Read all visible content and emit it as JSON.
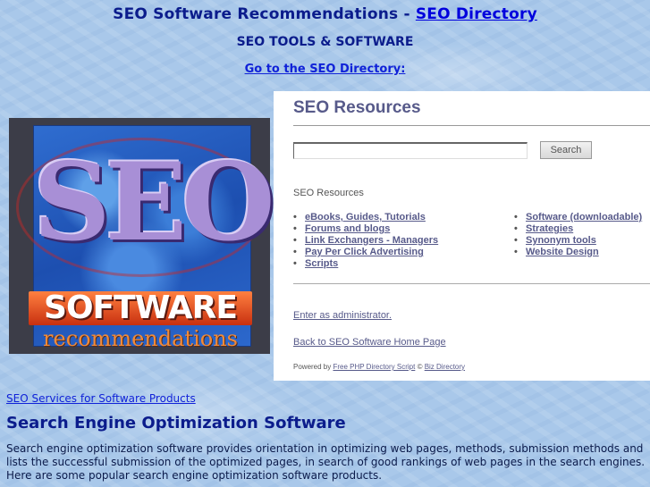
{
  "header": {
    "title_prefix": "SEO Software Recommendations - ",
    "title_link": "SEO Directory",
    "subtitle": "SEO TOOLS & SOFTWARE",
    "goto_link": "Go to the SEO Directory:"
  },
  "logo": {
    "seo_text": "SEO",
    "software_text": "SOFTWARE",
    "recommendations_text": "recommendations"
  },
  "panel": {
    "title": "SEO Resources",
    "search": {
      "value": "",
      "placeholder": "",
      "button_label": "Search"
    },
    "section_label": "SEO Resources",
    "categories_left": [
      "eBooks, Guides, Tutorials",
      "Forums and blogs",
      "Link Exchangers - Managers",
      "Pay Per Click Advertising",
      "Scripts"
    ],
    "categories_right": [
      "Software (downloadable)",
      "Strategies",
      "Synonym tools",
      "Website Design"
    ],
    "admin_link": "Enter as administrator.",
    "home_link": "Back to SEO Software Home Page",
    "powered_prefix": "Powered by ",
    "powered_link": "Free PHP Directory Script",
    "powered_sep": " © ",
    "powered_link2": "Biz Directory"
  },
  "content": {
    "services_link": "SEO Services for Software Products",
    "heading": "Search Engine Optimization Software",
    "intro": "Search engine optimization software provides orientation in optimizing web pages, methods, submission methods and lists the successful submission of the optimized pages, in search of good rankings of web pages in the search engines. Here are some popular search engine optimization software products."
  },
  "colors": {
    "background": "#a9c8ea",
    "heading": "#0b1c8c",
    "link": "#1022d8",
    "panel_link": "#575a8a",
    "logo_banner": "#e0501e"
  }
}
